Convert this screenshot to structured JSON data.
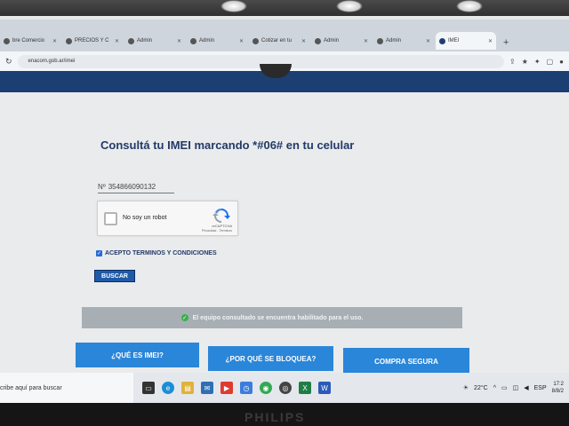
{
  "browser": {
    "tabs": [
      {
        "label": "bre Comercio",
        "active": false
      },
      {
        "label": "PRECIOS Y C",
        "active": false
      },
      {
        "label": "Admin",
        "active": false
      },
      {
        "label": "Admin",
        "active": false
      },
      {
        "label": "Cotizar en tu",
        "active": false
      },
      {
        "label": "Admin",
        "active": false
      },
      {
        "label": "Admin",
        "active": false
      },
      {
        "label": "IMEI",
        "active": true
      }
    ],
    "new_tab": "+",
    "url": "enacom.gob.ar/imei"
  },
  "page": {
    "title": "Consultá tu IMEI marcando *#06# en tu celular",
    "imei_prefix": "Nº",
    "imei_value": "354866090132",
    "recaptcha": {
      "label": "No soy un robot",
      "brand": "reCAPTCHA",
      "links": "Privacidad - Términos"
    },
    "terms_label": "ACEPTO TERMINOS Y CONDICIONES",
    "terms_checked": true,
    "search_button": "BUSCAR",
    "status_message": "El equipo consultado se encuentra habilitado para el uso.",
    "buttons": {
      "what_is_imei": "¿QUÉ ES IMEI?",
      "why_blocked": "¿POR QUÉ SE BLOQUEA?",
      "safe_purchase": "COMPRA SEGURA"
    }
  },
  "taskbar": {
    "search_placeholder": "cribe aquí para buscar",
    "temperature": "22°C",
    "language": "ESP",
    "time": "17:2",
    "date": "8/8/2"
  },
  "monitor": {
    "brand": "PHILIPS"
  },
  "colors": {
    "primary_blue": "#2a86d8",
    "title_navy": "#233a66",
    "status_bg": "#a8afb4",
    "success_green": "#3bb04a"
  }
}
